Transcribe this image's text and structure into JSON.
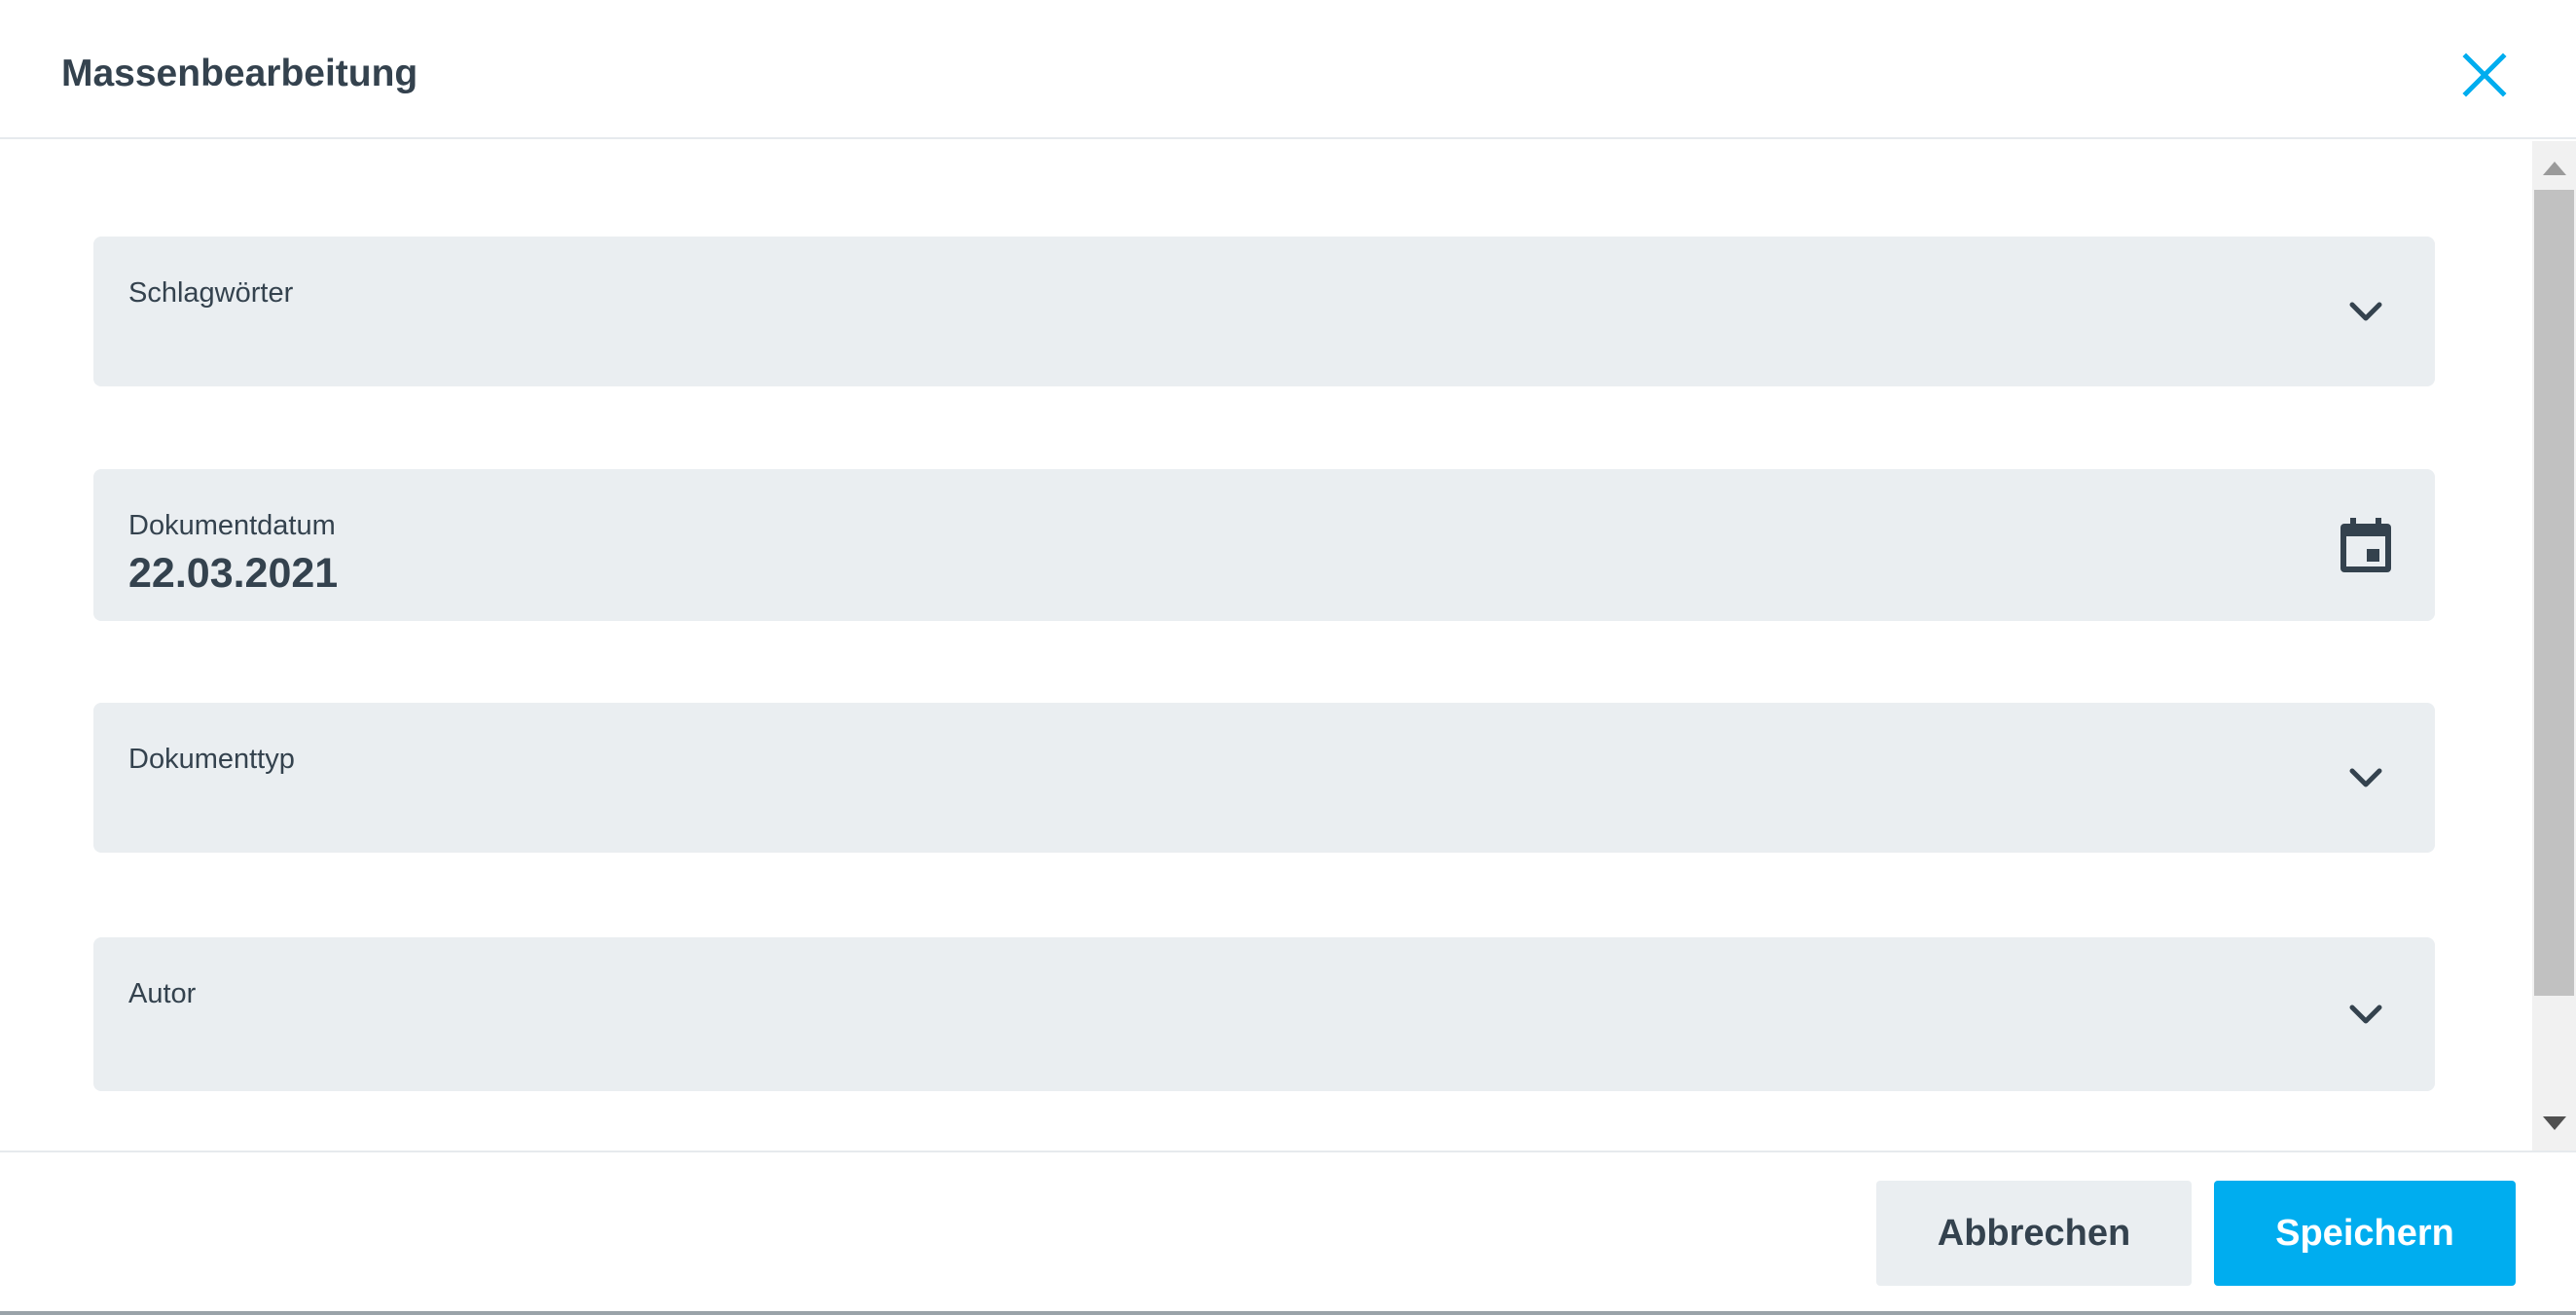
{
  "dialog": {
    "title": "Massenbearbeitung"
  },
  "icons": {
    "close": "close-icon",
    "dropdown": "chevron-down-icon",
    "calendar": "calendar-icon"
  },
  "fields": [
    {
      "label": "Schlagwörter",
      "value": "",
      "icon": "chevron-down-icon"
    },
    {
      "label": "Dokumentdatum",
      "value": "22.03.2021",
      "icon": "calendar-icon"
    },
    {
      "label": "Dokumenttyp",
      "value": "",
      "icon": "chevron-down-icon"
    },
    {
      "label": "Autor",
      "value": "",
      "icon": "chevron-down-icon"
    }
  ],
  "footer": {
    "cancel_label": "Abbrechen",
    "save_label": "Speichern"
  },
  "colors": {
    "accent": "#00adef",
    "text": "#34424e",
    "field_bg": "#eaeef1"
  }
}
